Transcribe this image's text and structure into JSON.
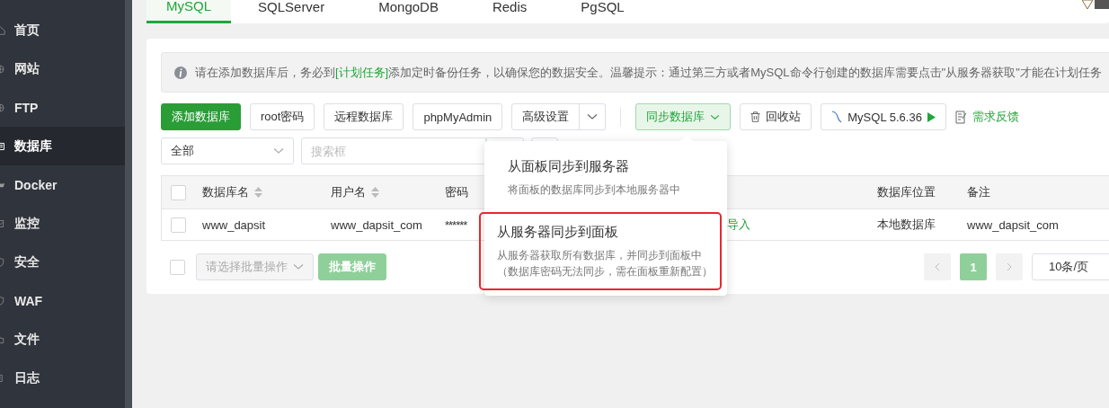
{
  "sidebar": {
    "items": [
      {
        "label": "首页",
        "selected": false
      },
      {
        "label": "网站",
        "selected": false
      },
      {
        "label": "FTP",
        "selected": false
      },
      {
        "label": "数据库",
        "selected": true
      },
      {
        "label": "Docker",
        "selected": false
      },
      {
        "label": "监控",
        "selected": false
      },
      {
        "label": "安全",
        "selected": false
      },
      {
        "label": "WAF",
        "selected": false
      },
      {
        "label": "文件",
        "selected": false
      },
      {
        "label": "日志",
        "selected": false
      }
    ]
  },
  "tabs": [
    {
      "label": "MySQL",
      "selected": true
    },
    {
      "label": "SQLServer",
      "selected": false
    },
    {
      "label": "MongoDB",
      "selected": false
    },
    {
      "label": "Redis",
      "selected": false
    },
    {
      "label": "PgSQL",
      "selected": false
    }
  ],
  "notice": {
    "before": "请在添加数据库后，务必到",
    "link": "[计划任务]",
    "after": "添加定时备份任务，以确保您的数据安全。温馨提示：通过第三方或者MySQL命令行创建的数据库需要点击\"从服务器获取\"才能在计划任务"
  },
  "toolbar": {
    "primary": "添加数据库",
    "buttons": [
      "root密码",
      "远程数据库",
      "phpMyAdmin"
    ],
    "advanced": "高级设置",
    "sync": "同步数据库",
    "recycle": "回收站",
    "version": "MySQL 5.6.36",
    "feedback": "需求反馈"
  },
  "filter": {
    "select": "全部",
    "search_placeholder": "搜索框"
  },
  "table": {
    "select_all_checked": false,
    "columns": [
      {
        "label": "数据库名",
        "sortable": true
      },
      {
        "label": "用户名",
        "sortable": true
      },
      {
        "label": "密码",
        "sortable": false
      },
      {
        "label": "数据库位置",
        "sortable": false
      },
      {
        "label": "备注",
        "sortable": false
      }
    ],
    "rows": [
      {
        "checked": false,
        "name": "www_dapsit",
        "user": "www_dapsit_com",
        "password": "******",
        "action": "导入",
        "location": "本地数据库",
        "remark": "www_dapsit_com"
      }
    ]
  },
  "footer": {
    "select_all_checked": false,
    "batch_placeholder": "请选择批量操作",
    "batch_button": "批量操作",
    "pages": [
      {
        "label": "1",
        "selected": true
      }
    ],
    "page_size": "10条/页"
  },
  "sync_menu": {
    "items": [
      {
        "title": "从面板同步到服务器",
        "lines": [
          "将面板的数据库同步到本地服务器中"
        ],
        "highlighted": false
      },
      {
        "title": "从服务器同步到面板",
        "lines": [
          "从服务器获取所有数据库，并同步到面板中",
          "（数据库密码无法同步，需在面板重新配置）"
        ],
        "highlighted": true
      }
    ]
  }
}
